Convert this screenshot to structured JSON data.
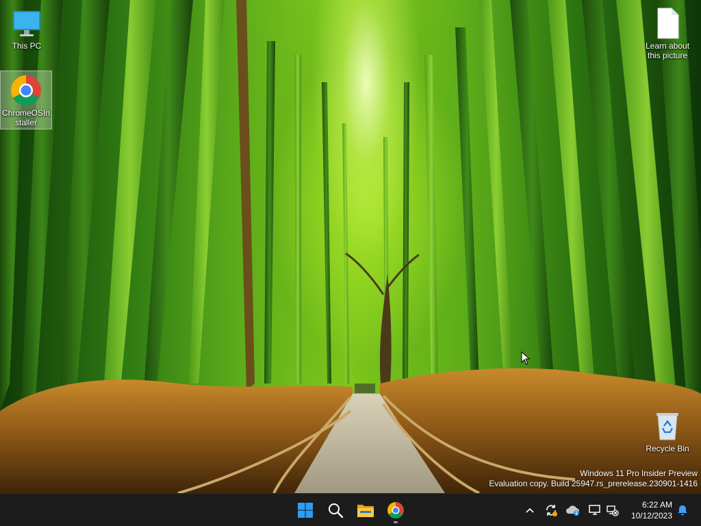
{
  "desktop": {
    "icons": [
      {
        "label": "This PC",
        "icon": "monitor-icon"
      },
      {
        "label": "ChromeOSInstaller",
        "icon": "chrome-icon"
      },
      {
        "label": "Learn about this picture",
        "icon": "document-icon"
      },
      {
        "label": "Recycle Bin",
        "icon": "recycle-bin-icon"
      }
    ],
    "watermark": {
      "line1": "Windows 11 Pro Insider Preview",
      "line2": "Evaluation copy. Build 25947.rs_prerelease.230901-1416"
    }
  },
  "taskbar": {
    "pinned": [
      {
        "name": "Start",
        "icon": "windows-start-icon"
      },
      {
        "name": "Search",
        "icon": "search-icon"
      },
      {
        "name": "File Explorer",
        "icon": "folder-icon"
      },
      {
        "name": "Google Chrome",
        "icon": "chrome-icon",
        "running": true
      }
    ],
    "tray": {
      "icons": [
        "chevron-up-icon",
        "sync-icon",
        "onedrive-icon",
        "display-icon",
        "network-disconnected-icon"
      ],
      "time": "6:22 AM",
      "date": "10/12/2023",
      "notification_icon": "bell-icon"
    }
  },
  "colors": {
    "taskbar_bg": "#1c1c1c",
    "accent": "#0078d4",
    "start_blue": "#2b9df4",
    "bell": "#3ba0ff"
  }
}
